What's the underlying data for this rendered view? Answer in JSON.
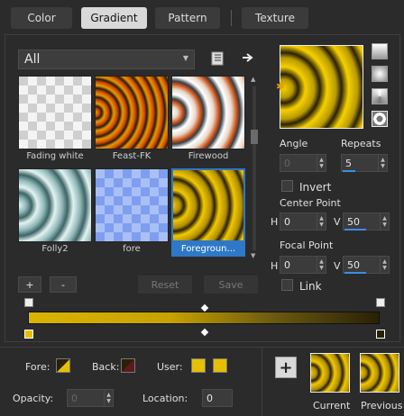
{
  "tabs": [
    {
      "label": "Color"
    },
    {
      "label": "Gradient"
    },
    {
      "label": "Pattern"
    },
    {
      "label": "Texture"
    }
  ],
  "library": {
    "category": "All",
    "items": [
      {
        "name": "Fading white"
      },
      {
        "name": "Feast-FK"
      },
      {
        "name": "Firewood"
      },
      {
        "name": "Folly2"
      },
      {
        "name": "fore"
      },
      {
        "name": "Foregroun..."
      }
    ]
  },
  "buttons": {
    "add": "+",
    "remove": "-",
    "reset": "Reset",
    "save": "Save"
  },
  "settings": {
    "angle_label": "Angle",
    "angle_value": "0",
    "repeats_label": "Repeats",
    "repeats_value": "5",
    "invert_label": "Invert",
    "center_point_label": "Center Point",
    "center_h_label": "H",
    "center_h": "0",
    "center_v_label": "V",
    "center_v": "50",
    "focal_point_label": "Focal Point",
    "focal_h_label": "H",
    "focal_h": "0",
    "focal_v_label": "V",
    "focal_v": "50",
    "link_label": "Link"
  },
  "bottom": {
    "fore_label": "Fore:",
    "back_label": "Back:",
    "user_label": "User:",
    "opacity_label": "Opacity:",
    "opacity_value": "0",
    "location_label": "Location:",
    "location_value": "0",
    "current_label": "Current",
    "previous_label": "Previous"
  },
  "colors": {
    "gold": "#e6c000",
    "dark": "#2a2006",
    "accent": "#2e78c8"
  }
}
